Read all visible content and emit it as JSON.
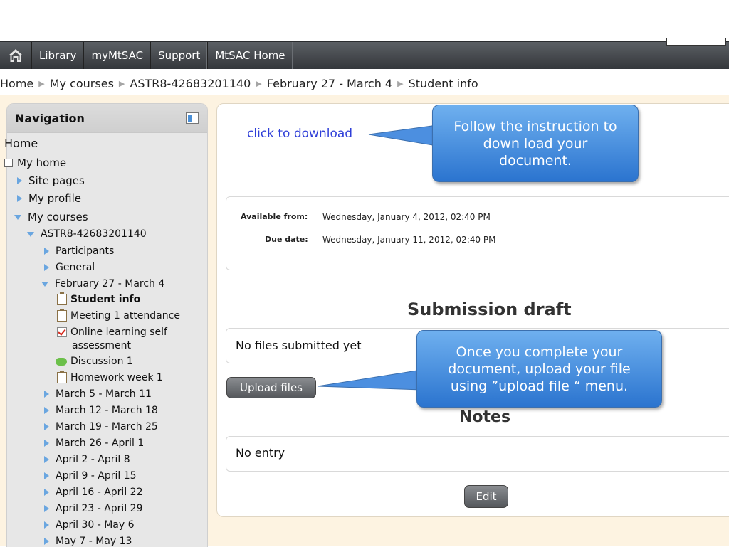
{
  "navbar": {
    "home_icon": "home-icon",
    "links": [
      "Library",
      "myMtSAC",
      "Support",
      "MtSAC Home"
    ]
  },
  "breadcrumb": [
    "Home",
    "My courses",
    "ASTR8-42683201140",
    "February 27 - March 4",
    "Student info"
  ],
  "navigation": {
    "title": "Navigation",
    "home": "Home",
    "my_home": "My home",
    "site_pages": "Site pages",
    "my_profile": "My profile",
    "my_courses": "My courses",
    "course": "ASTR8-42683201140",
    "participants": "Participants",
    "general": "General",
    "current_week": "February 27 - March 4",
    "activities": [
      "Student info",
      "Meeting 1 attendance",
      "Online learning self",
      "assessment",
      "Discussion 1",
      "Homework week 1"
    ],
    "weeks": [
      "March 5 - March 11",
      "March 12 - March 18",
      "March 19 - March 25",
      "March 26 - April 1",
      "April 2 - April 8",
      "April 9 - April 15",
      "April 16 - April 22",
      "April 23 - April 29",
      "April 30 - May 6",
      "May 7 - May 13"
    ]
  },
  "main": {
    "download_link": "click to download",
    "available_from_label": "Available from:",
    "available_from_value": "Wednesday, January 4, 2012, 02:40 PM",
    "due_date_label": "Due date:",
    "due_date_value": "Wednesday, January 11, 2012, 02:40 PM",
    "submission_heading": "Submission draft",
    "no_files": "No files submitted yet",
    "upload_button": "Upload files",
    "notes_heading": "Notes",
    "no_entry": "No entry",
    "edit_button": "Edit"
  },
  "callouts": {
    "download": "Follow the instruction to down load your document.",
    "upload": "Once you complete your document, upload your file using ”upload file “ menu."
  },
  "colors": {
    "navbar": "#4a4d51",
    "callout_blue": "#3f8ae0",
    "page_background": "#fdf3e1",
    "link": "#2f3fd8"
  }
}
